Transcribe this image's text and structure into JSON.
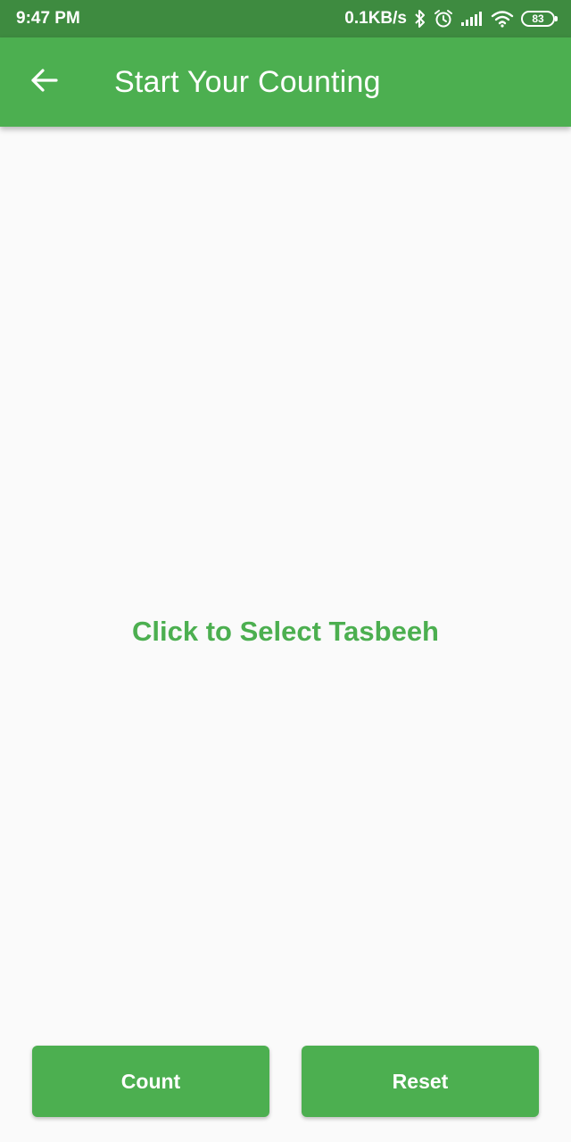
{
  "status_bar": {
    "time": "9:47 PM",
    "network_speed": "0.1KB/s",
    "battery_level": "83",
    "icons": [
      "bluetooth-icon",
      "alarm-icon",
      "signal-icon",
      "wifi-icon",
      "battery-icon"
    ]
  },
  "app_bar": {
    "title": "Start Your Counting",
    "back_icon": "arrow-back-icon",
    "color": "#4caf50"
  },
  "main": {
    "select_prompt": "Click to Select Tasbeeh"
  },
  "actions": {
    "count_label": "Count",
    "reset_label": "Reset"
  },
  "colors": {
    "primary": "#4caf50",
    "status_bar": "#3e8b40",
    "background": "#fafafa"
  }
}
